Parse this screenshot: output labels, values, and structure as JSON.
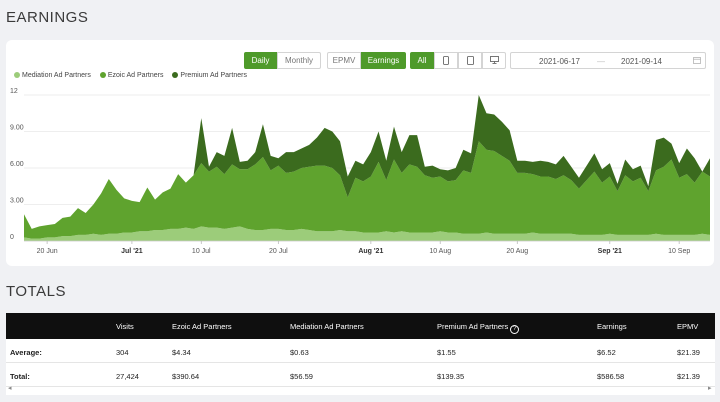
{
  "earnings_title": "EARNINGS",
  "totals_title": "TOTALS",
  "controls": {
    "daily": "Daily",
    "monthly": "Monthly",
    "epmv": "EPMV",
    "earnings": "Earnings",
    "all": "All",
    "mobile_icon": "mobile-icon",
    "tablet_icon": "tablet-icon",
    "desktop_icon": "desktop-icon",
    "date_from": "2021-06-17",
    "date_sep": "—",
    "date_to": "2021-09-14",
    "calendar_icon": "calendar-icon"
  },
  "colors": {
    "mediation": "#9ccc7a",
    "ezoic": "#5fa32e",
    "premium": "#3b6b1e",
    "accent": "#4e9a2a"
  },
  "chart_data": {
    "type": "area",
    "stacked": true,
    "x_start": "2021-06-17",
    "x_end": "2021-09-14",
    "ylim": [
      0,
      12
    ],
    "yticks": [
      "0",
      "3.00",
      "6.00",
      "9.00",
      "12"
    ],
    "xticks": [
      {
        "label": "20 Jun",
        "date": "2021-06-20",
        "bold": false
      },
      {
        "label": "Jul '21",
        "date": "2021-07-01",
        "bold": true
      },
      {
        "label": "10 Jul",
        "date": "2021-07-10",
        "bold": false
      },
      {
        "label": "20 Jul",
        "date": "2021-07-20",
        "bold": false
      },
      {
        "label": "Aug '21",
        "date": "2021-08-01",
        "bold": true
      },
      {
        "label": "10 Aug",
        "date": "2021-08-10",
        "bold": false
      },
      {
        "label": "20 Aug",
        "date": "2021-08-20",
        "bold": false
      },
      {
        "label": "Sep '21",
        "date": "2021-09-01",
        "bold": true
      },
      {
        "label": "10 Sep",
        "date": "2021-09-10",
        "bold": false
      }
    ],
    "grid": true,
    "legend_position": "top-left",
    "series": [
      {
        "name": "Mediation Ad Partners",
        "values": [
          0.3,
          0.2,
          0.2,
          0.3,
          0.3,
          0.4,
          0.4,
          0.5,
          0.5,
          0.6,
          0.5,
          0.6,
          0.6,
          0.7,
          0.7,
          0.8,
          0.8,
          0.9,
          0.9,
          1.0,
          1.0,
          1.1,
          1.0,
          1.2,
          1.1,
          1.1,
          1.0,
          1.1,
          1.2,
          1.0,
          0.9,
          0.9,
          1.0,
          1.0,
          0.9,
          0.9,
          1.0,
          0.9,
          0.8,
          0.8,
          0.8,
          0.9,
          0.8,
          0.8,
          0.7,
          0.7,
          0.7,
          0.8,
          0.7,
          0.8,
          0.7,
          0.7,
          0.7,
          0.7,
          0.8,
          0.7,
          0.7,
          0.6,
          0.6,
          0.6,
          0.7,
          0.6,
          0.6,
          0.6,
          0.6,
          0.6,
          0.7,
          0.6,
          0.6,
          0.6,
          0.6,
          0.6,
          0.5,
          0.5,
          0.5,
          0.5,
          0.6,
          0.5,
          0.5,
          0.5,
          0.5,
          0.5,
          0.6,
          0.5,
          0.5,
          0.5,
          0.5,
          0.5,
          0.6,
          0.5
        ]
      },
      {
        "name": "Ezoic Ad Partners",
        "values": [
          1.9,
          0.8,
          1.0,
          1.0,
          1.1,
          1.5,
          1.6,
          2.2,
          1.8,
          2.4,
          3.4,
          4.5,
          3.6,
          2.8,
          2.6,
          2.4,
          3.6,
          2.5,
          3.1,
          3.3,
          4.5,
          3.7,
          4.4,
          5.2,
          4.6,
          5.0,
          4.5,
          5.2,
          4.7,
          4.9,
          5.4,
          6.0,
          4.8,
          5.2,
          4.7,
          4.8,
          5.0,
          5.2,
          5.4,
          5.4,
          5.2,
          4.5,
          2.8,
          4.4,
          4.2,
          4.6,
          5.8,
          4.2,
          6.0,
          4.8,
          5.6,
          5.4,
          4.7,
          4.5,
          4.5,
          4.2,
          4.3,
          5.2,
          5.0,
          7.6,
          6.8,
          6.8,
          6.4,
          6.0,
          5.0,
          5.0,
          4.8,
          4.7,
          4.7,
          4.5,
          4.8,
          4.4,
          3.8,
          4.5,
          5.2,
          4.3,
          4.7,
          3.6,
          4.9,
          4.4,
          4.7,
          3.6,
          5.2,
          5.6,
          6.2,
          4.7,
          5.0,
          4.3,
          5.1,
          4.8
        ]
      },
      {
        "name": "Premium Ad Partners",
        "values": [
          0.0,
          0.0,
          0.0,
          0.0,
          0.0,
          0.0,
          0.0,
          0.0,
          0.0,
          0.0,
          0.0,
          0.0,
          0.0,
          0.0,
          0.0,
          0.0,
          0.0,
          0.0,
          0.0,
          0.0,
          0.0,
          0.0,
          0.0,
          3.7,
          0.4,
          1.2,
          1.5,
          3.0,
          0.6,
          0.7,
          1.0,
          2.7,
          1.2,
          0.6,
          1.7,
          1.6,
          1.6,
          1.8,
          2.3,
          3.1,
          3.0,
          2.8,
          1.7,
          1.4,
          1.4,
          2.0,
          2.5,
          1.6,
          2.7,
          1.7,
          2.4,
          2.6,
          0.7,
          1.0,
          0.6,
          0.9,
          1.0,
          1.7,
          1.6,
          3.8,
          3.0,
          3.0,
          2.8,
          2.5,
          1.0,
          1.0,
          1.0,
          1.3,
          1.2,
          1.2,
          1.6,
          1.1,
          0.9,
          1.2,
          1.5,
          1.1,
          1.1,
          0.6,
          1.3,
          1.0,
          1.0,
          0.4,
          2.5,
          2.4,
          1.3,
          1.2,
          2.1,
          2.0,
          0.0,
          1.5
        ]
      }
    ]
  },
  "table": {
    "headers": [
      "Visits",
      "Ezoic Ad Partners",
      "Mediation Ad Partners",
      "Premium Ad Partners",
      "Earnings",
      "EPMV"
    ],
    "rows": [
      {
        "label": "Average:",
        "cells": [
          "304",
          "$4.34",
          "$0.63",
          "$1.55",
          "$6.52",
          "$21.39"
        ]
      },
      {
        "label": "Total:",
        "cells": [
          "27,424",
          "$390.64",
          "$56.59",
          "$139.35",
          "$586.58",
          "$21.39"
        ]
      }
    ],
    "help_glyph": "?",
    "scroll_left": "◂",
    "scroll_right": "▸"
  }
}
